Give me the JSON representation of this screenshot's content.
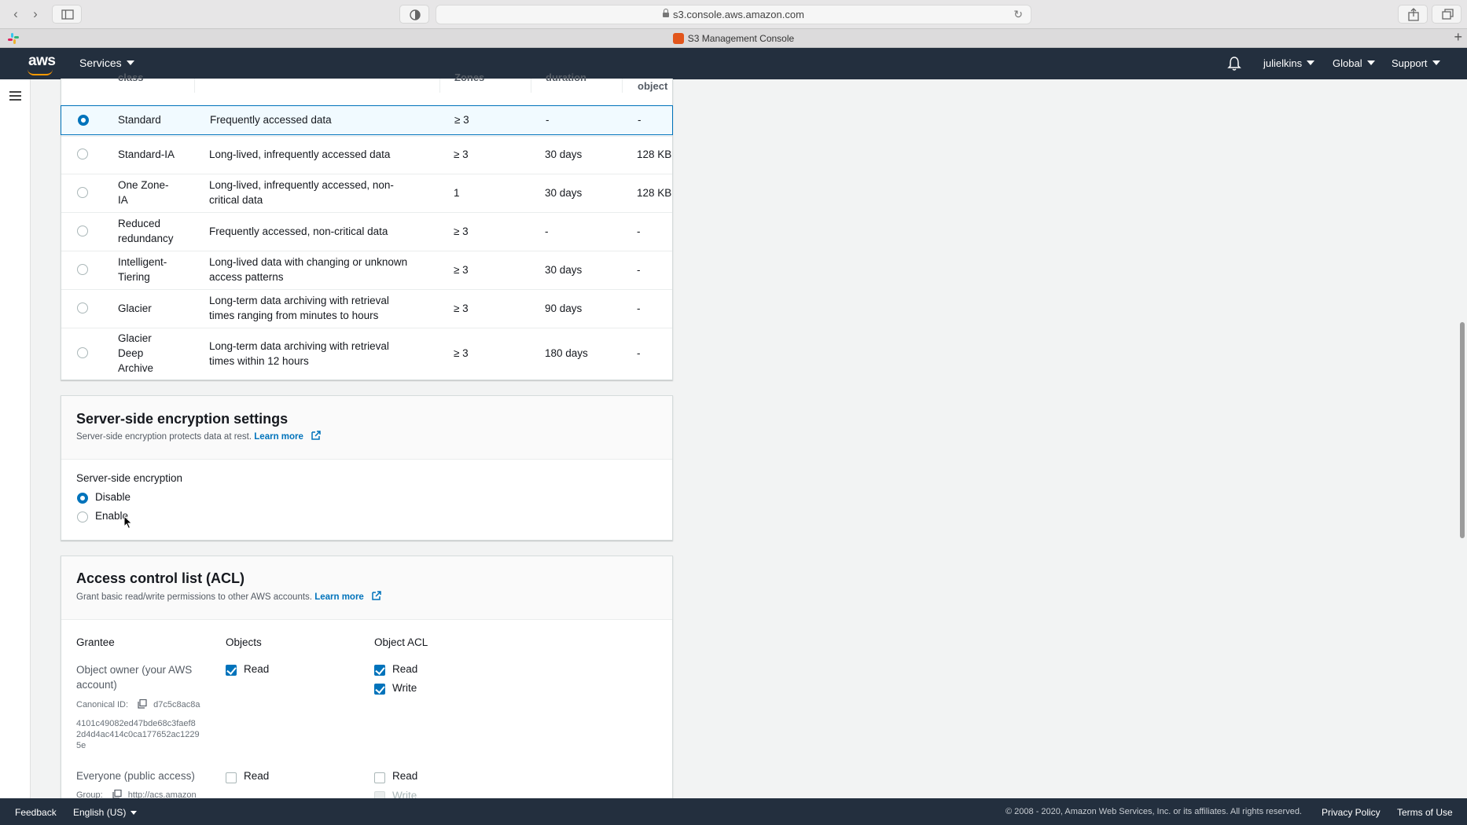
{
  "browser": {
    "url": "s3.console.aws.amazon.com",
    "tab_title": "S3 Management Console"
  },
  "aws_nav": {
    "logo": "aws",
    "services": "Services",
    "user": "julielkins",
    "region": "Global",
    "support": "Support"
  },
  "storage_table": {
    "headers": {
      "class": "class",
      "zones": "Zones",
      "duration": "duration",
      "object": "object"
    },
    "rows": [
      {
        "class_lines": [
          "Standard"
        ],
        "desc_lines": [
          "Frequently accessed data"
        ],
        "zones": "≥ 3",
        "duration": "-",
        "size": "-",
        "selected": true
      },
      {
        "class_lines": [
          "Standard-IA"
        ],
        "desc_lines": [
          "Long-lived, infrequently accessed data"
        ],
        "zones": "≥ 3",
        "duration": "30 days",
        "size": "128 KB",
        "selected": false
      },
      {
        "class_lines": [
          "One Zone-",
          "IA"
        ],
        "desc_lines": [
          "Long-lived, infrequently accessed, non-",
          "critical data"
        ],
        "zones": "1",
        "duration": "30 days",
        "size": "128 KB",
        "selected": false
      },
      {
        "class_lines": [
          "Reduced",
          "redundancy"
        ],
        "desc_lines": [
          "Frequently accessed, non-critical data"
        ],
        "zones": "≥ 3",
        "duration": "-",
        "size": "-",
        "selected": false
      },
      {
        "class_lines": [
          "Intelligent-",
          "Tiering"
        ],
        "desc_lines": [
          "Long-lived data with changing or unknown",
          "access patterns"
        ],
        "zones": "≥ 3",
        "duration": "30 days",
        "size": "-",
        "selected": false
      },
      {
        "class_lines": [
          "Glacier"
        ],
        "desc_lines": [
          "Long-term data archiving with retrieval",
          "times ranging from minutes to hours"
        ],
        "zones": "≥ 3",
        "duration": "90 days",
        "size": "-",
        "selected": false
      },
      {
        "class_lines": [
          "Glacier",
          "Deep",
          "Archive"
        ],
        "desc_lines": [
          "Long-term data archiving with retrieval",
          "times within 12 hours"
        ],
        "zones": "≥ 3",
        "duration": "180 days",
        "size": "-",
        "selected": false
      }
    ]
  },
  "encryption": {
    "title": "Server-side encryption settings",
    "desc": "Server-side encryption protects data at rest.",
    "learn_more": "Learn more",
    "field_label": "Server-side encryption",
    "options": [
      {
        "label": "Disable",
        "selected": true
      },
      {
        "label": "Enable",
        "selected": false
      }
    ]
  },
  "acl": {
    "title": "Access control list (ACL)",
    "desc": "Grant basic read/write permissions to other AWS accounts.",
    "learn_more": "Learn more",
    "col_grantee": "Grantee",
    "col_objects": "Objects",
    "col_object_acl": "Object ACL",
    "owner": {
      "name_lines": [
        "Object owner (your AWS",
        "account)"
      ],
      "canonical_label": "Canonical ID:",
      "canonical_first": "d7c5c8ac8a",
      "canonical_rest": [
        "4101c49082ed47bde68c3faef8",
        "2d4d4ac414c0ca177652ac1229",
        "5e"
      ],
      "objects_read": "Read",
      "acl_read": "Read",
      "acl_write": "Write"
    },
    "everyone": {
      "name": "Everyone (public access)",
      "group_label": "Group:",
      "group_value": "http://acs.amazon",
      "objects_read": "Read",
      "acl_read": "Read",
      "acl_write": "Write"
    }
  },
  "footer": {
    "feedback": "Feedback",
    "language": "English (US)",
    "copyright": "© 2008 - 2020, Amazon Web Services, Inc. or its affiliates. All rights reserved.",
    "privacy": "Privacy Policy",
    "terms": "Terms of Use"
  },
  "colors": {
    "aws_nav": "#232f3e",
    "accent_blue": "#0073bb",
    "aws_orange": "#ff9900"
  }
}
